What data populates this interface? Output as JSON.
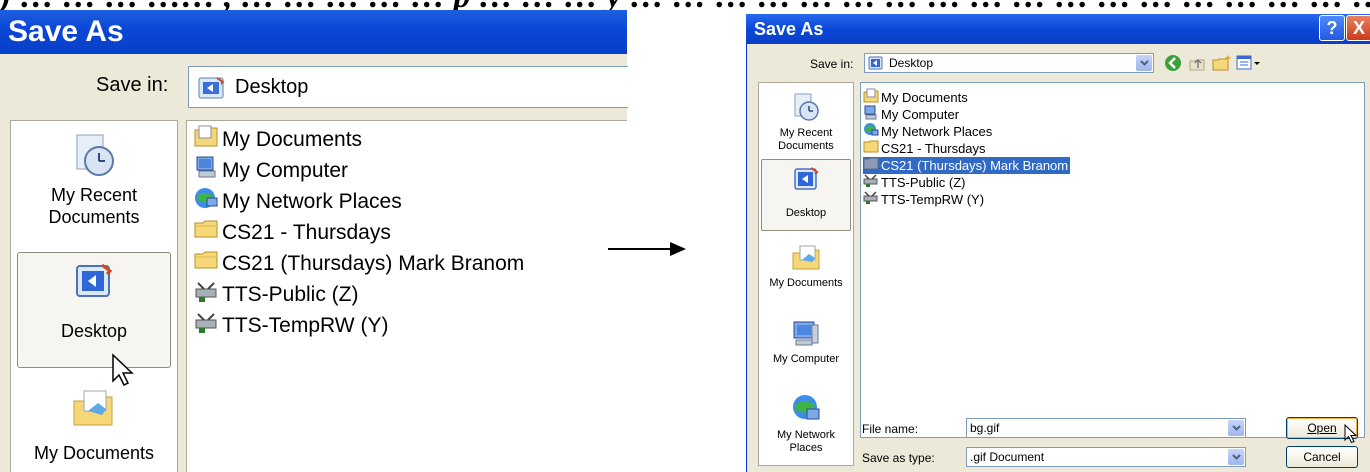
{
  "heading_fragment": ") … … … …… , … … … … … p … … … y … … … … … … … … … … … … … … … … … … , … … … … … … p",
  "left_dialog": {
    "title": "Save As",
    "save_in_label": "Save in:",
    "save_in_value": "Desktop",
    "places": [
      {
        "label": "My Recent\nDocuments",
        "icon": "recent-documents-icon"
      },
      {
        "label": "Desktop",
        "icon": "desktop-icon",
        "selected": true
      },
      {
        "label": "My Documents",
        "icon": "my-documents-icon"
      }
    ],
    "files": [
      {
        "name": "My Documents",
        "icon": "my-documents-folder-icon"
      },
      {
        "name": "My Computer",
        "icon": "computer-icon"
      },
      {
        "name": "My Network Places",
        "icon": "network-places-icon"
      },
      {
        "name": "CS21 - Thursdays",
        "icon": "folder-icon"
      },
      {
        "name": "CS21 (Thursdays) Mark Branom",
        "icon": "folder-icon"
      },
      {
        "name": "TTS-Public (Z)",
        "icon": "network-drive-icon"
      },
      {
        "name": "TTS-TempRW (Y)",
        "icon": "network-drive-icon"
      }
    ]
  },
  "right_dialog": {
    "title": "Save As",
    "help_label": "?",
    "close_label": "X",
    "save_in_label": "Save in:",
    "save_in_value": "Desktop",
    "places": [
      {
        "label": "My Recent Documents",
        "icon": "recent-documents-icon"
      },
      {
        "label": "Desktop",
        "icon": "desktop-icon",
        "selected": true
      },
      {
        "label": "My Documents",
        "icon": "my-documents-icon"
      },
      {
        "label": "My Computer",
        "icon": "computer-icon"
      },
      {
        "label": "My Network Places",
        "icon": "network-places-icon"
      }
    ],
    "files": [
      {
        "name": "My Documents",
        "icon": "my-documents-folder-icon"
      },
      {
        "name": "My Computer",
        "icon": "computer-icon"
      },
      {
        "name": "My Network Places",
        "icon": "network-places-icon"
      },
      {
        "name": "CS21 - Thursdays",
        "icon": "folder-icon"
      },
      {
        "name": "CS21 (Thursdays) Mark Branom",
        "icon": "folder-icon",
        "selected": true
      },
      {
        "name": "TTS-Public (Z)",
        "icon": "network-drive-icon"
      },
      {
        "name": "TTS-TempRW (Y)",
        "icon": "network-drive-icon"
      }
    ],
    "file_name_label": "File name:",
    "file_name_value": "bg.gif",
    "save_as_type_label": "Save as type:",
    "save_as_type_value": ".gif Document",
    "open_button": "Open",
    "cancel_button": "Cancel"
  },
  "colors": {
    "titlebar": "#0a46d6",
    "dialog_bg": "#ece9d8",
    "selection": "#316ac5"
  }
}
